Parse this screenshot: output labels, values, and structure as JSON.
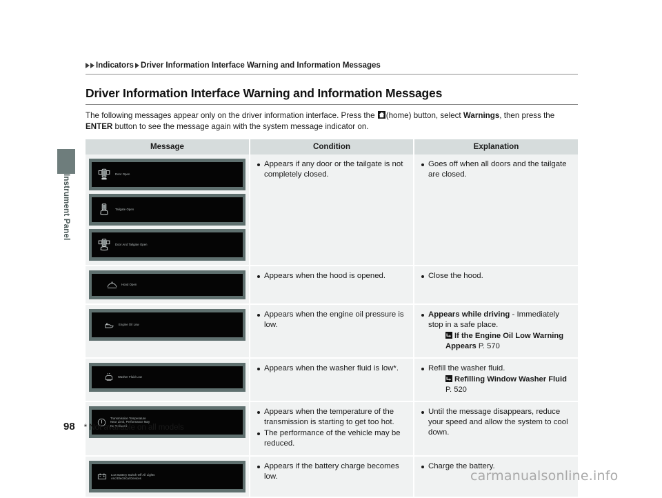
{
  "sidebar": {
    "label": "Instrument Panel",
    "tab_color": "#6e7d7c"
  },
  "breadcrumb": {
    "item1": "Indicators",
    "item2": "Driver Information Interface Warning and Information Messages"
  },
  "page_title": "Driver Information Interface Warning and Information Messages",
  "intro": {
    "part1": "The following messages appear only on the driver information interface. Press the ",
    "home_label": "(home) button, select ",
    "warnings": "Warnings",
    "part2": ", then press the ",
    "enter": "ENTER",
    "part3": " button to see the message again with the system message indicator on."
  },
  "table": {
    "headers": {
      "message": "Message",
      "condition": "Condition",
      "explanation": "Explanation"
    },
    "rows": [
      {
        "thumbs": [
          {
            "icon": "car-door-open-icon",
            "text": "Door Open"
          },
          {
            "icon": "car-tailgate-open-icon",
            "text": "Tailgate Open"
          },
          {
            "icon": "car-door-and-tailgate-open-icon",
            "text": "Door And Tailgate Open"
          }
        ],
        "condition": [
          "Appears if any door or the tailgate is not completely closed."
        ],
        "explanation": [
          "Goes off when all doors and the tailgate are closed."
        ]
      },
      {
        "thumbs": [
          {
            "icon": "hood-open-icon",
            "text": "Hood Open"
          }
        ],
        "condition": [
          "Appears when the hood is opened."
        ],
        "explanation": [
          "Close the hood."
        ]
      },
      {
        "thumbs": [
          {
            "icon": "engine-oil-low-icon",
            "text": "Engine Oil Low"
          }
        ],
        "condition": [
          "Appears when the engine oil pressure is low."
        ],
        "explanation_bold": "Appears while driving",
        "explanation_rest": " - Immediately stop in a safe place.",
        "reference": {
          "bold": "If the Engine Oil Low Warning Appears",
          "page": "P. 570"
        }
      },
      {
        "thumbs": [
          {
            "icon": "washer-fluid-low-icon",
            "text": "Washer Fluid Low"
          }
        ],
        "condition": [
          "Appears when the washer fluid is low*."
        ],
        "explanation": [
          "Refill the washer fluid."
        ],
        "reference": {
          "bold": "Refilling Window Washer Fluid",
          "page": "P. 520"
        }
      },
      {
        "thumbs": [
          {
            "icon": "transmission-temperature-icon",
            "text": "Transmission Temperature Near Limit, Performance May Be Reduced"
          }
        ],
        "condition": [
          "Appears when the temperature of the transmission is starting to get too hot.",
          "The performance of the vehicle may be reduced."
        ],
        "explanation": [
          "Until the message disappears, reduce your speed and allow the system to cool down."
        ]
      },
      {
        "thumbs": [
          {
            "icon": "low-battery-icon",
            "text": "Low Battery Switch Off All Lights And Electrical Devices"
          }
        ],
        "condition": [
          "Appears if the battery charge becomes low."
        ],
        "explanation": [
          "Charge the battery."
        ]
      }
    ]
  },
  "footer": {
    "page_number": "98",
    "footnote": "* Not available on all models"
  },
  "watermark": "carmanualsonline.info"
}
